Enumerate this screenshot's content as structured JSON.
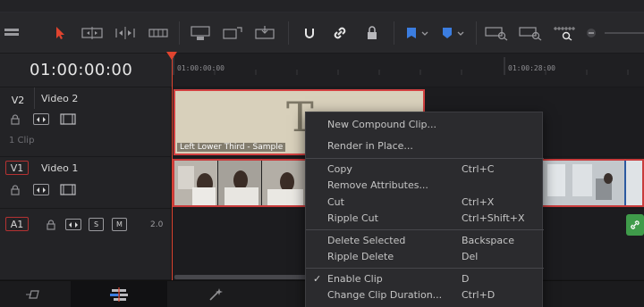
{
  "timeline": {
    "timecode": "01:00:00:00",
    "ruler_labels": [
      "01:00:00:00",
      "01:00:28:00"
    ]
  },
  "toolbar": {
    "icons": [
      "selection-tool-icon",
      "trim-tool-icon",
      "dynamic-trim-icon",
      "blade-tool-icon",
      "insert-clip-icon",
      "overwrite-clip-icon",
      "replace-clip-icon",
      "snapping-icon",
      "linked-selection-icon",
      "position-lock-icon",
      "flag-icon",
      "marker-icon",
      "zoom-full-icon",
      "zoom-detail-icon",
      "zoom-custom-icon"
    ],
    "accent_color": "#3b7de0"
  },
  "tracks": {
    "v2": {
      "tag": "V2",
      "name": "Video 2",
      "clip_count": "1 Clip"
    },
    "v1": {
      "tag": "V1",
      "name": "Video 1"
    },
    "a1": {
      "tag": "A1",
      "solo": "S",
      "mute": "M",
      "channels": "2.0"
    }
  },
  "clips": {
    "title_clip": {
      "glyph": "T",
      "name": "Left Lower Third - Sample"
    }
  },
  "context_menu": {
    "items": [
      {
        "label": "New Compound Clip...",
        "shortcut": ""
      },
      {
        "label": "Render in Place...",
        "shortcut": ""
      },
      {
        "label": "Copy",
        "shortcut": "Ctrl+C"
      },
      {
        "label": "Remove Attributes...",
        "shortcut": ""
      },
      {
        "label": "Cut",
        "shortcut": "Ctrl+X"
      },
      {
        "label": "Ripple Cut",
        "shortcut": "Ctrl+Shift+X"
      },
      {
        "label": "Delete Selected",
        "shortcut": "Backspace"
      },
      {
        "label": "Ripple Delete",
        "shortcut": "Del"
      },
      {
        "label": "Enable Clip",
        "shortcut": "D",
        "checked": "✓"
      },
      {
        "label": "Change Clip Duration...",
        "shortcut": "Ctrl+D"
      }
    ]
  },
  "bottom_tabs": [
    "cut-page-icon",
    "edit-page-icon",
    "fusion-page-icon"
  ]
}
